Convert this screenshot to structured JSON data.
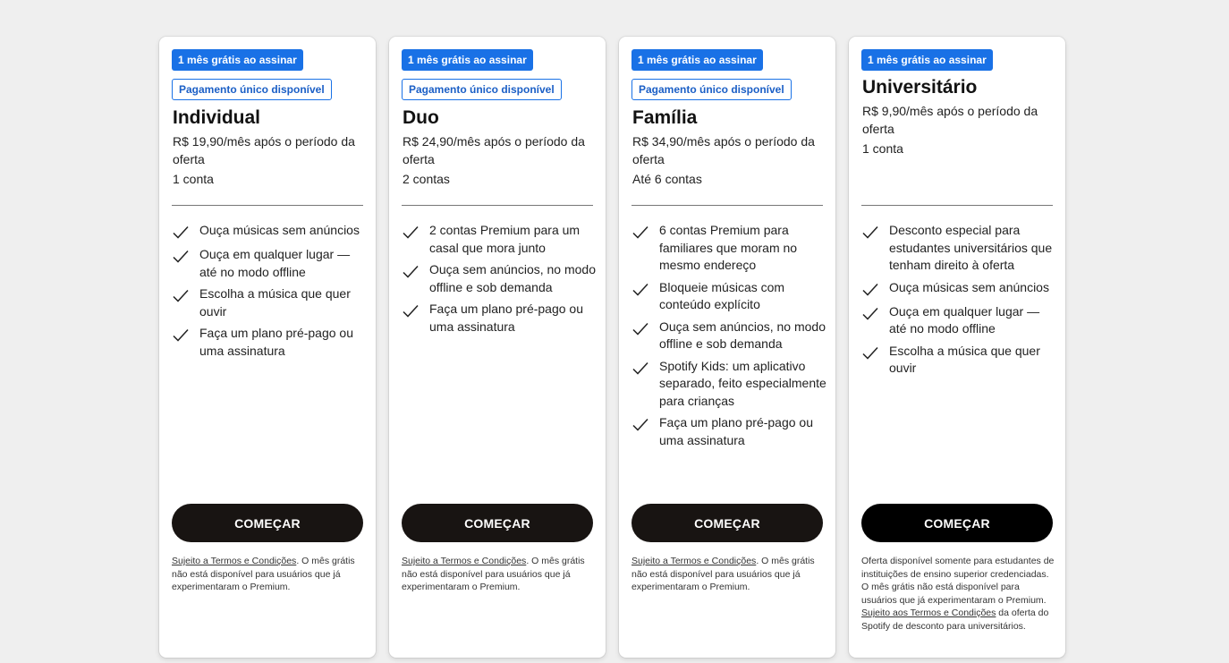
{
  "plans": [
    {
      "badge_free": "1 mês grátis ao assinar",
      "badge_once": "Pagamento único disponível",
      "name": "Individual",
      "price": "R$ 19,90/mês após o período da oferta",
      "accounts": "1 conta",
      "features": [
        "Ouça músicas sem anúncios",
        "Ouça em qualquer lugar — até no modo offline",
        "Escolha a música que quer ouvir",
        "Faça um plano pré-pago ou uma assinatura"
      ],
      "cta": "COMEÇAR",
      "terms_link": "Sujeito a Termos e Condições",
      "terms_text": ". O mês grátis não está disponível para usuários que já experimentaram o Premium."
    },
    {
      "badge_free": "1 mês grátis ao assinar",
      "badge_once": "Pagamento único disponível",
      "name": "Duo",
      "price": "R$ 24,90/mês após o período da oferta",
      "accounts": "2 contas",
      "features": [
        "2 contas Premium para um casal que mora junto",
        "Ouça sem anúncios, no modo offline e sob demanda",
        "Faça um plano pré-pago ou uma assinatura"
      ],
      "cta": "COMEÇAR",
      "terms_link": "Sujeito a Termos e Condições",
      "terms_text": ". O mês grátis não está disponível para usuários que já experimentaram o Premium."
    },
    {
      "badge_free": "1 mês grátis ao assinar",
      "badge_once": "Pagamento único disponível",
      "name": "Família",
      "price": "R$ 34,90/mês após o período da oferta",
      "accounts": "Até 6 contas",
      "features": [
        "6 contas Premium para familiares que moram no mesmo endereço",
        "Bloqueie músicas com conteúdo explícito",
        "Ouça sem anúncios, no modo offline e sob demanda",
        "Spotify Kids: um aplicativo separado, feito especialmente para crianças",
        "Faça um plano pré-pago ou uma assinatura"
      ],
      "cta": "COMEÇAR",
      "terms_link": "Sujeito a Termos e Condições",
      "terms_text": ". O mês grátis não está disponível para usuários que já experimentaram o Premium."
    },
    {
      "badge_free": "1 mês grátis ao assinar",
      "name": "Universitário",
      "price": "R$ 9,90/mês após o período da oferta",
      "accounts": "1 conta",
      "features": [
        "Desconto especial para estudantes universitários que tenham direito à oferta",
        "Ouça músicas sem anúncios",
        "Ouça em qualquer lugar — até no modo offline",
        "Escolha a música que quer ouvir"
      ],
      "cta": "COMEÇAR",
      "terms_pre": "Oferta disponível somente para estudantes de instituições de ensino superior credenciadas. O mês grátis não está disponível para usuários que já experimentaram o Premium. ",
      "terms_link": "Sujeito aos Termos e Condições",
      "terms_text": " da oferta do Spotify de desconto para universitários."
    }
  ],
  "colors": {
    "badge_blue": "#1971e6",
    "button_dark": "#181412",
    "page_bg": "#efefef"
  },
  "icons": {
    "feature_bullet": "check-icon"
  }
}
